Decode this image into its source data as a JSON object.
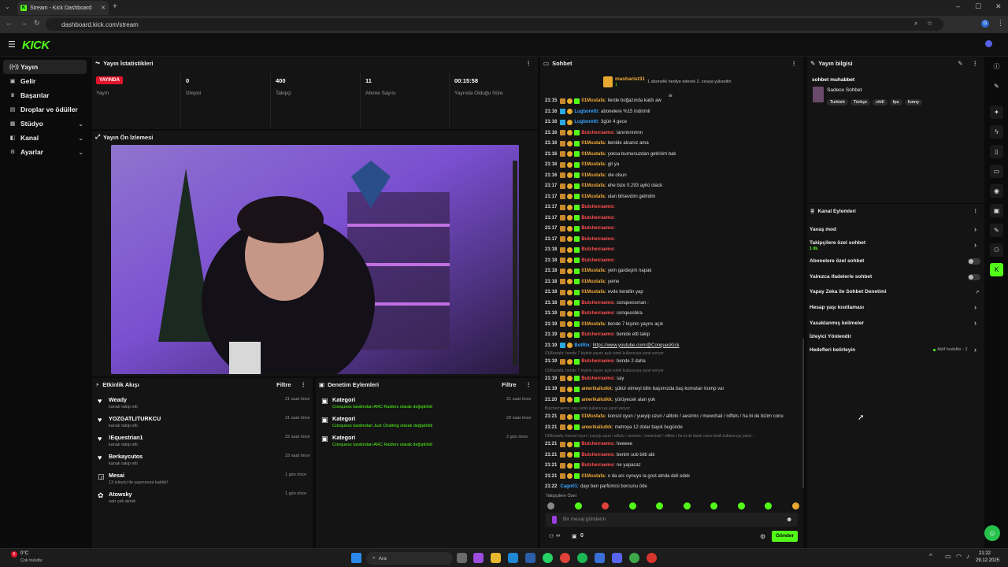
{
  "browser": {
    "tab_title": "Stream - Kick Dashboard",
    "url": "dashboard.kick.com/stream"
  },
  "brand": {
    "logo": "KICK"
  },
  "sidebar": {
    "items": [
      {
        "label": "Yayın",
        "icon": "broadcast-icon"
      },
      {
        "label": "Gelir",
        "icon": "money-icon"
      },
      {
        "label": "Başarılar",
        "icon": "trophy-icon"
      },
      {
        "label": "Droplar ve ödüller",
        "icon": "gift-icon"
      },
      {
        "label": "Stüdyo",
        "icon": "studio-icon"
      },
      {
        "label": "Kanal",
        "icon": "channel-icon"
      },
      {
        "label": "Ayarlar",
        "icon": "settings-icon"
      }
    ]
  },
  "stats": {
    "title": "Yayın İstatistikleri",
    "live_badge": "YAYINDA",
    "live_label": "Yayın",
    "viewers": "0",
    "viewers_label": "İzleyici",
    "followers": "400",
    "followers_label": "Takipçi",
    "subs": "11",
    "subs_label": "Abone Sayısı",
    "uptime": "00:15:58",
    "uptime_label": "Yayında Olduğu Süre"
  },
  "preview": {
    "title": "Yayın Ön İzlemesi"
  },
  "activity": {
    "title": "Etkinlik Akışı",
    "filter": "Filtre",
    "items": [
      {
        "name": "Weady",
        "desc": "kanalı takip etti",
        "time": "21 saat önce"
      },
      {
        "name": "YOZGATLITURKCU",
        "desc": "kanalı takip etti",
        "time": "21 saat önce"
      },
      {
        "name": "!Equestrian1",
        "desc": "kanalı takip etti",
        "time": "22 saat önce"
      },
      {
        "name": "Berkaycutos",
        "desc": "kanalı takip etti",
        "time": "23 saat önce"
      },
      {
        "name": "Mesai",
        "desc": "13 izleyici ile yayınınıza katıldı!",
        "time": "1 gün önce"
      },
      {
        "name": "Atowsky",
        "desc": "nah çek alındı",
        "time": "1 gün önce"
      }
    ]
  },
  "moderation": {
    "title": "Denetim Eylemleri",
    "filter": "Filtre",
    "items": [
      {
        "name": "Kategori",
        "desc": "Conquess tarafından ARC Raiders olarak değiştirildi",
        "time": "21 saat önce"
      },
      {
        "name": "Kategori",
        "desc": "Conquess tarafından Just Chatting olarak değiştirildi",
        "time": "23 saat önce"
      },
      {
        "name": "Kategori",
        "desc": "Conquess tarafından ARC Raiders olarak değiştirildi",
        "time": "2 gün önce"
      }
    ]
  },
  "chat": {
    "title": "Sohbet",
    "pinned_user": "masharist31",
    "pinned_count": "1",
    "pinned_text": "1 abonelik hediye ederek 2. sıraya yükseltin",
    "messages": [
      {
        "t": "21:15",
        "u": "01Mustafa:",
        "c": "y",
        "m": "ilerde boğazında kaldı aw"
      },
      {
        "t": "21:16",
        "u": "Lugboretti:",
        "c": "b",
        "m": "abonelere %15 indirimli"
      },
      {
        "t": "21:16",
        "u": "Lugboretti:",
        "c": "b",
        "m": "3gün 4 gece"
      },
      {
        "t": "21:16",
        "u": "Butcherraemo:",
        "c": "r",
        "m": "lanınnnnnnn"
      },
      {
        "t": "21:16",
        "u": "01Mustafa:",
        "c": "y",
        "m": "benide alcanız ama"
      },
      {
        "t": "21:16",
        "u": "01Mustafa:",
        "c": "y",
        "m": "yoksa burnunuzdan getiririm bak"
      },
      {
        "t": "21:16",
        "u": "01Mustafa:",
        "c": "y",
        "m": "git ya"
      },
      {
        "t": "21:16",
        "u": "01Mustafa:",
        "c": "y",
        "m": "ole olsun"
      },
      {
        "t": "21:17",
        "u": "01Mustafa:",
        "c": "y",
        "m": "ehe bize 0.293 aykü olack"
      },
      {
        "t": "21:17",
        "u": "01Mustafa:",
        "c": "y",
        "m": "ulan bilsevdim gelirdim"
      },
      {
        "t": "21:17",
        "u": "Butcherraemo:",
        "c": "r",
        "m": ""
      },
      {
        "t": "21:17",
        "u": "Butcherraemo:",
        "c": "r",
        "m": ""
      },
      {
        "t": "21:17",
        "u": "Butcherraemo:",
        "c": "r",
        "m": ""
      },
      {
        "t": "21:17",
        "u": "Butcherraemo:",
        "c": "r",
        "m": ""
      },
      {
        "t": "21:18",
        "u": "Butcherraemo:",
        "c": "r",
        "m": ""
      },
      {
        "t": "21:18",
        "u": "Butcherraemo:",
        "c": "r",
        "m": ""
      },
      {
        "t": "21:18",
        "u": "01Mustafa:",
        "c": "y",
        "m": "yem gardeşim napak"
      },
      {
        "t": "21:18",
        "u": "01Mustafa:",
        "c": "y",
        "m": "yeme"
      },
      {
        "t": "21:18",
        "u": "01Mustafa:",
        "c": "y",
        "m": "evde kendlin yap"
      },
      {
        "t": "21:18",
        "u": "Butcherraemo:",
        "c": "r",
        "m": "conquessınan :"
      },
      {
        "t": "21:19",
        "u": "Butcherraemo:",
        "c": "r",
        "m": "conquesbira"
      },
      {
        "t": "21:19",
        "u": "01Mustafa:",
        "c": "y",
        "m": "bende 7 kişinin yayını açık"
      },
      {
        "t": "21:19",
        "u": "Butcherraemo:",
        "c": "r",
        "m": "benide etti takip"
      },
      {
        "t": "21:19",
        "u": "BotRix:",
        "c": "b",
        "m": "https://www.youtube.com/@ConquesKick"
      }
    ],
    "messages2": [
      {
        "reply": "01Mustafa: bende 7 kişinin yayını açık isimli kullanıcıya yanıt veriyor",
        "t": "21:19",
        "u": "Butcherraemo:",
        "c": "r",
        "m": "bende 2 daha"
      },
      {
        "reply": "01Mustafa: bende 7 kişinin yayını açık isimli kullanıcıya yanıt veriyor",
        "t": "21:19",
        "u": "Butcherraemo:",
        "c": "r",
        "m": "say"
      },
      {
        "reply": "",
        "t": "21:19",
        "u": "amerikaliutkk:",
        "c": "y",
        "m": "şükür etmeyi bilin başımızda baş komutan trump var"
      },
      {
        "reply": "",
        "t": "21:20",
        "u": "amerikaliutkk:",
        "c": "y",
        "m": "yürüyecek alan yok"
      },
      {
        "reply": "Butcherraemo: say isimli kullanıcıya yanıt veriyor",
        "t": "21:21",
        "u": "01Mustafa:",
        "c": "y",
        "m": "konsol oyun / yueyip uzun / alltotv / aesirmc / mewchail / niffels / ha bi de bizim conu"
      },
      {
        "reply": "",
        "t": "21:21",
        "u": "amerikaliutkk:",
        "c": "y",
        "m": "metroya 12 dolar bayık bugünde"
      },
      {
        "reply": "01Mustafa: konsol oyun / yueyip uzun / alltotv / aesirmc / mewchail / niffels / ha bi de bizim conu isimli kullanıcıya yanıt...",
        "t": "21:21",
        "u": "Butcherraemo:",
        "c": "r",
        "m": "heeeee"
      },
      {
        "reply": "",
        "t": "21:21",
        "u": "Butcherraemo:",
        "c": "r",
        "m": "benim sub bitti abi"
      },
      {
        "reply": "",
        "t": "21:21",
        "u": "Butcherraemo:",
        "c": "r",
        "m": "ne yapacaz"
      },
      {
        "reply": "",
        "t": "21:21",
        "u": "01Mustafa:",
        "c": "y",
        "m": "o da arc oynuyo la gost atnda deli edek"
      },
      {
        "reply": "",
        "t": "21:22",
        "u": "Cago01:",
        "c": "b",
        "m": "dayı ben parfümcü borcunu öde"
      }
    ],
    "followers_only": "Takipçilere Özel",
    "input_placeholder": "Bir mesaj gönderin",
    "send_label": "Gönder",
    "users_count": "0",
    "infinity": "∞"
  },
  "stream_info": {
    "title": "Yayın bilgisi",
    "stream_title": "sohbet muhabbet",
    "category": "Sadece Sohbet",
    "tags": [
      "Turkish",
      "Türkçe",
      "chill",
      "fps",
      "funny"
    ]
  },
  "channel_actions": {
    "title": "Kanal Eylemleri",
    "slow_mode": "Yavaş mod",
    "followers_chat": "Takipçilere özel sohbet",
    "followers_chat_sub": "1 dk.",
    "subs_chat": "Abonelere özel sohbet",
    "emotes_chat": "Yalnızca ifadelerle sohbet",
    "ai_mod": "Yapay Zeka ile Sohbet Denetimi",
    "age_limit": "Hesap yaşı kısıtlaması",
    "banned_words": "Yasaklanmış kelimeler",
    "viewer_redirect": "İzleyici Yönlendir",
    "goals": "Hedefleri belirleyin",
    "goals_status": "Aktif hedefler - 2"
  },
  "taskbar": {
    "weather_temp": "0°C",
    "weather_desc": "Çok bulutlu",
    "search": "Ara",
    "time": "21:22",
    "date": "29.12.2025",
    "weather_badge": "6"
  },
  "colors": {
    "brand": "#53fc18",
    "live": "#e0142b",
    "panel": "#141414"
  }
}
